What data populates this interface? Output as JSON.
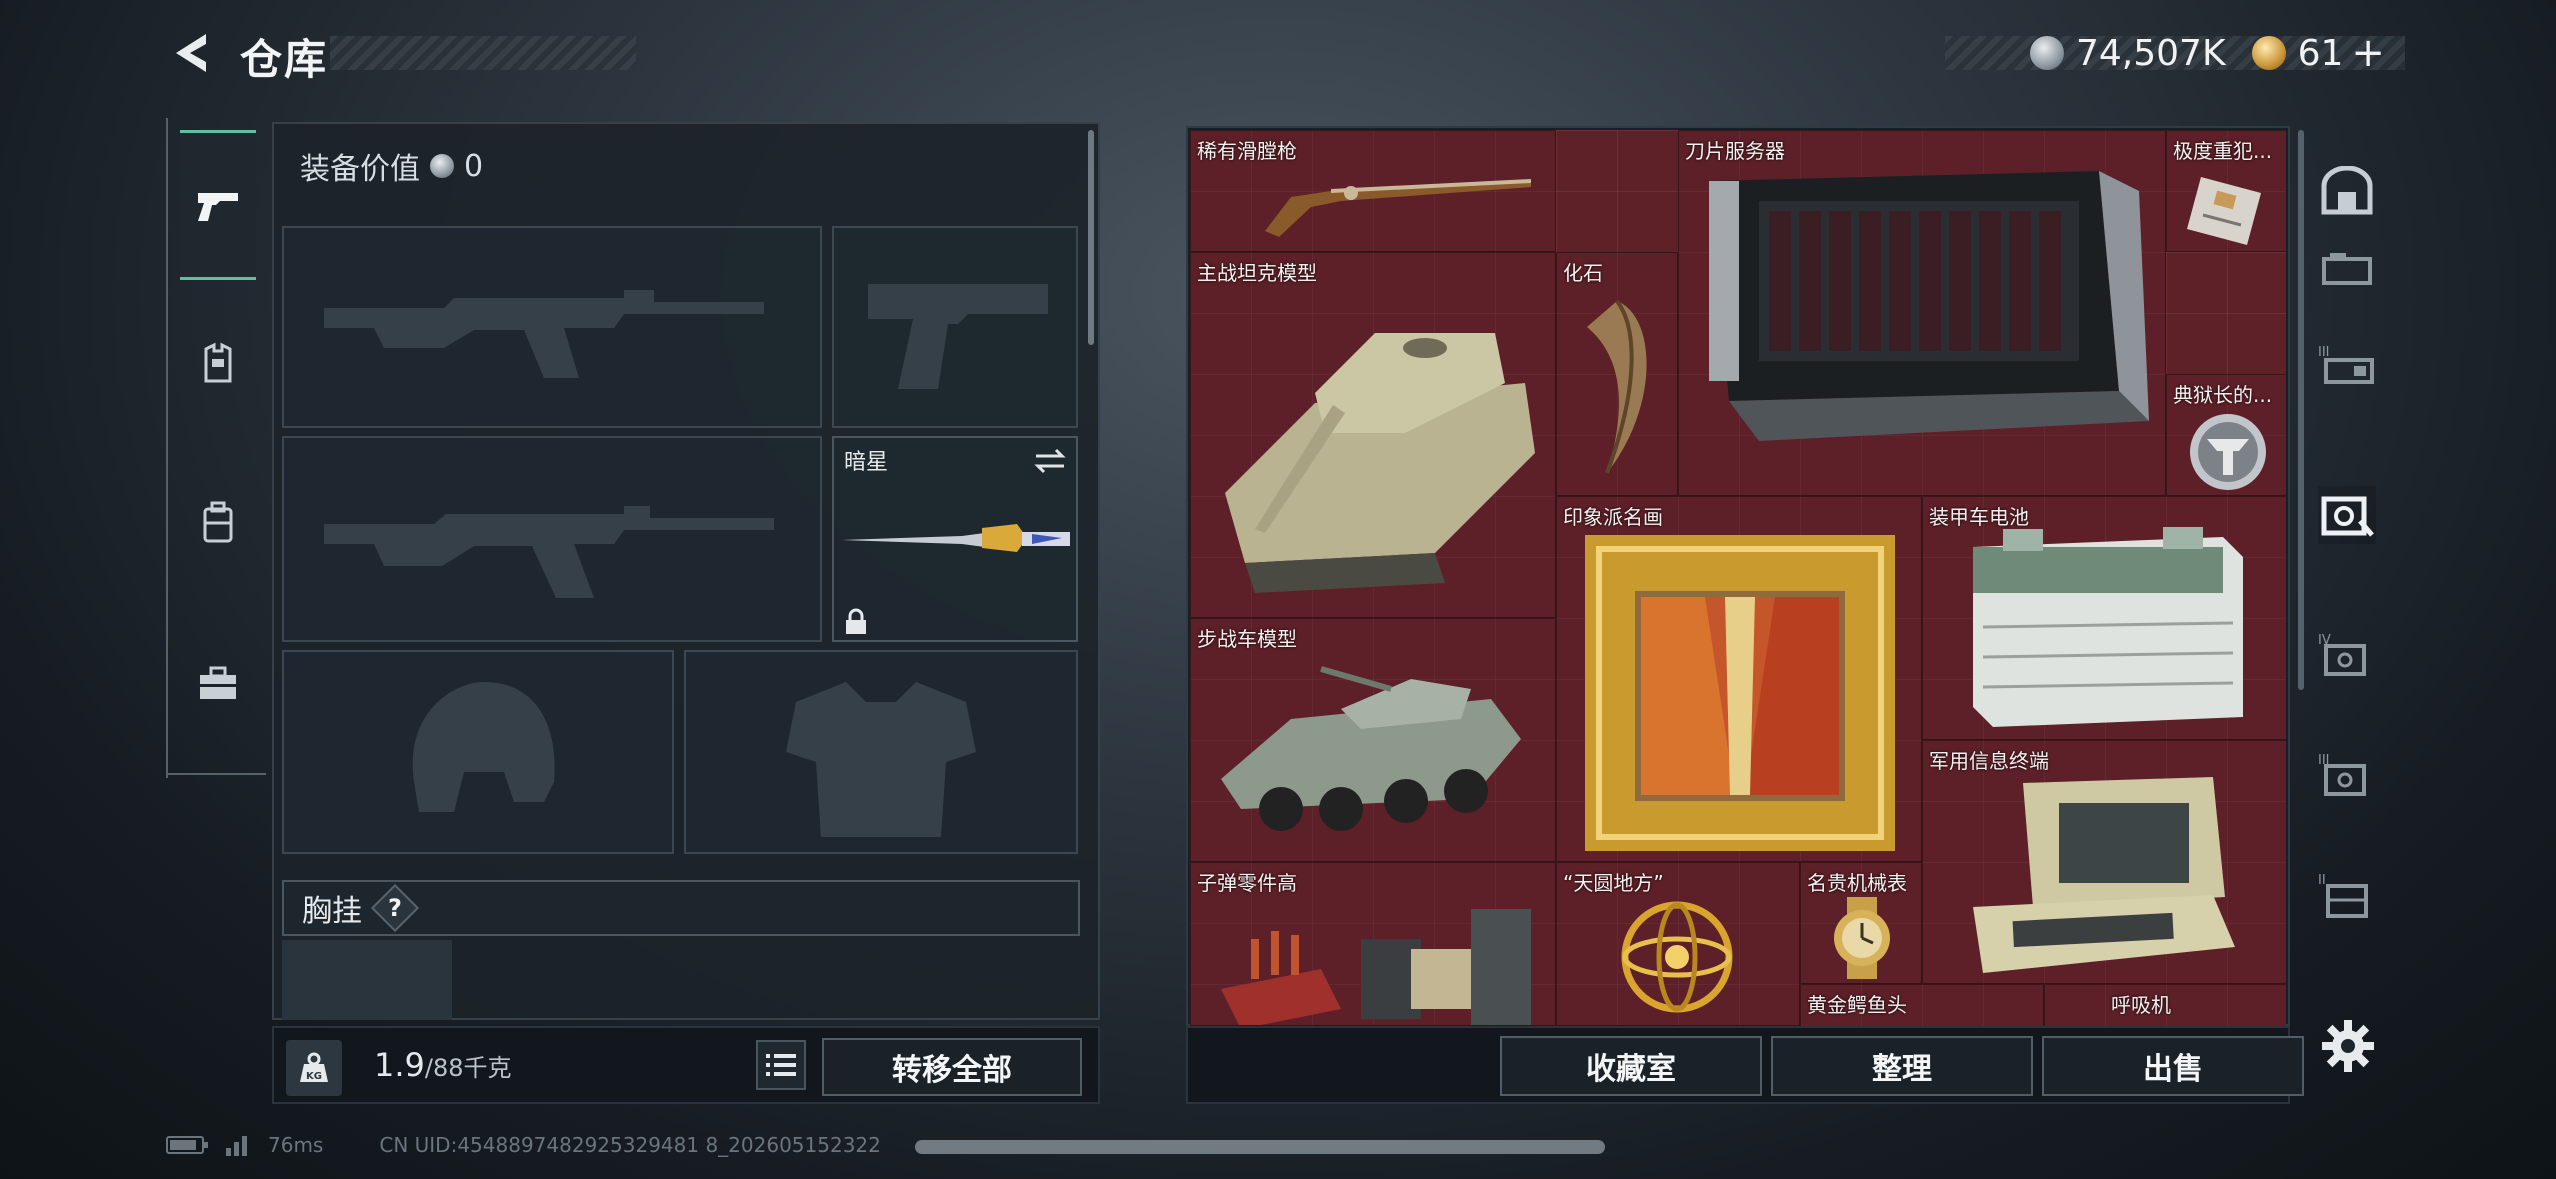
{
  "header": {
    "title": "仓库",
    "silver_amount": "74,507K",
    "gold_amount": "61",
    "add_label": "+"
  },
  "left_rail": [
    "weapons",
    "armor",
    "backpack",
    "tools"
  ],
  "equipment": {
    "value_label": "装备价值",
    "value": "0",
    "melee_name": "暗星",
    "chest_rig_label": "胸挂",
    "help_label": "?"
  },
  "weight": {
    "current": "1.9",
    "max": "/88",
    "unit": "千克"
  },
  "buttons": {
    "transfer_all": "转移全部",
    "collection": "收藏室",
    "sort": "整理",
    "sell": "出售"
  },
  "stash_items": [
    {
      "name": "稀有滑膛枪"
    },
    {
      "name": "刀片服务器"
    },
    {
      "name": "极度重犯..."
    },
    {
      "name": "主战坦克模型"
    },
    {
      "name": "化石"
    },
    {
      "name": "典狱长的..."
    },
    {
      "name": "印象派名画"
    },
    {
      "name": "装甲车电池"
    },
    {
      "name": "步战车模型"
    },
    {
      "name": "军用信息终端"
    },
    {
      "name": "子弹零件高"
    },
    {
      "name": "“天圆地方”"
    },
    {
      "name": "名贵机械表"
    },
    {
      "name": "黄金鳄鱼头"
    },
    {
      "name": "呼吸机"
    }
  ],
  "right_rail_tiers": [
    "",
    "",
    "III",
    "",
    "IV",
    "III",
    "II"
  ],
  "status": {
    "ping": "76ms",
    "uid": "CN UID:4548897482925329481 8_202605152322"
  },
  "colors": {
    "stash_bg": "#5e2128",
    "accent": "#5cc3a0"
  }
}
